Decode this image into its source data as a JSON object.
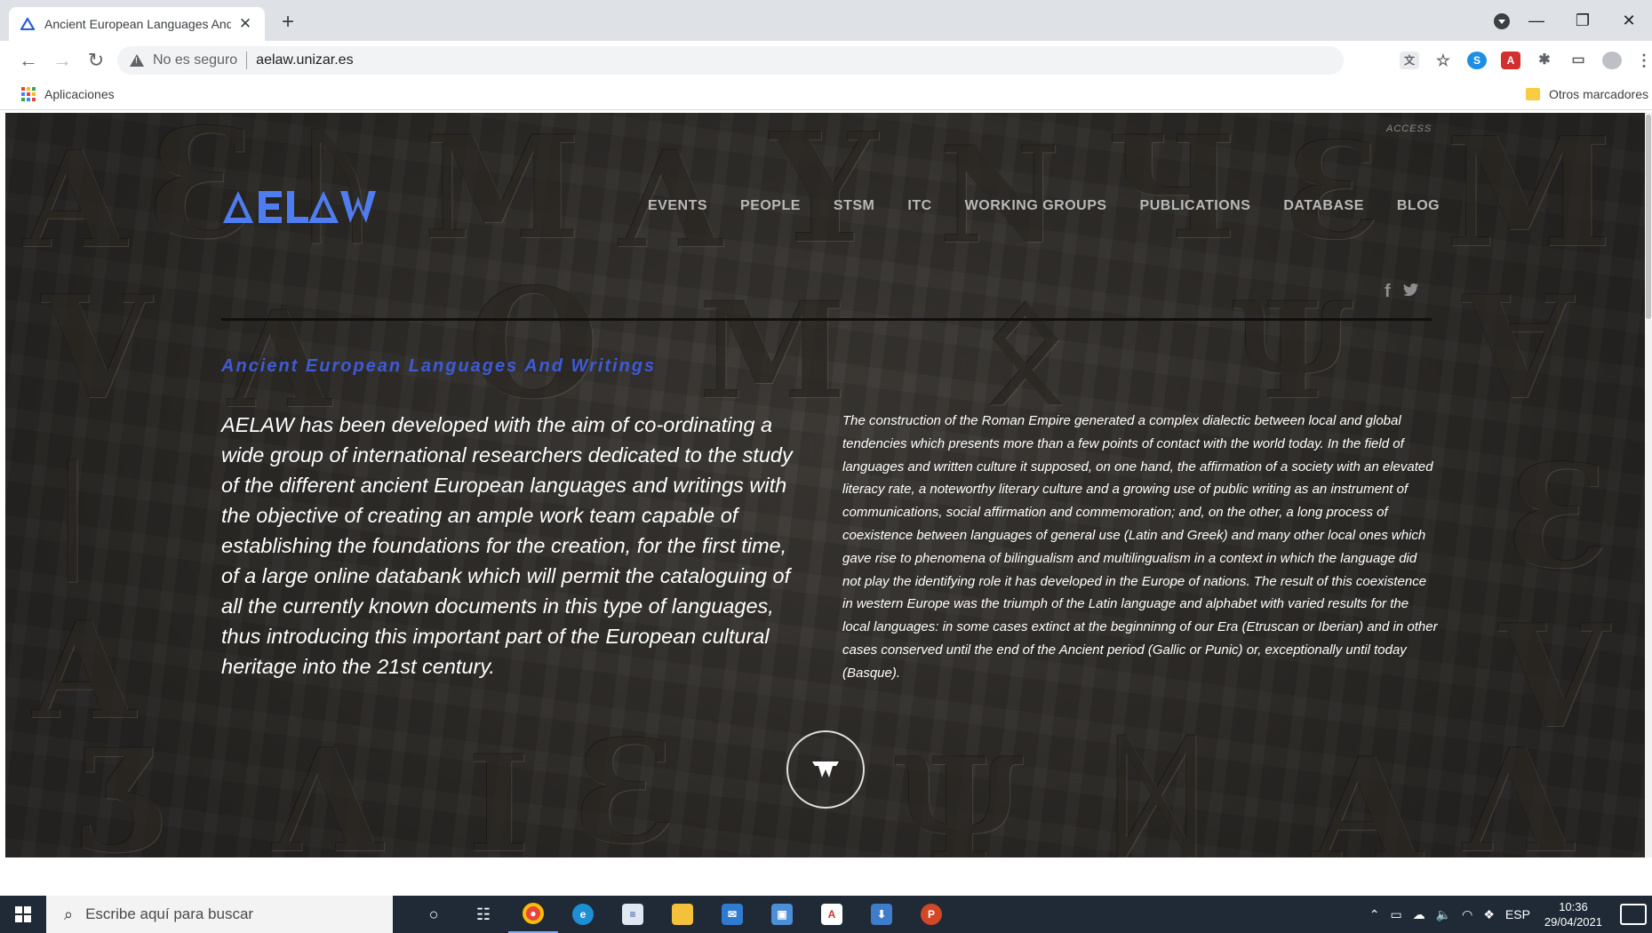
{
  "browser": {
    "tab_title": "Ancient European Languages And Writings",
    "new_tab_symbol": "+",
    "close_symbol": "✕",
    "window_controls": {
      "minimize": "—",
      "restore": "❐",
      "close": "✕"
    },
    "security_label": "No es seguro",
    "url": "aelaw.unizar.es",
    "bookmarks": {
      "apps_label": "Aplicaciones",
      "other_label": "Otros marcadores"
    }
  },
  "site": {
    "access_label": "ACCESS",
    "logo_text": "ΔELΔW",
    "nav": [
      "EVENTS",
      "PEOPLE",
      "STSM",
      "ITC",
      "WORKING GROUPS",
      "PUBLICATIONS",
      "DATABASE",
      "BLOG"
    ],
    "social": {
      "facebook": "f",
      "twitter": "🐦"
    },
    "subtitle": "Ancient European Languages And Writings",
    "lead_text": "AELAW has been developed with the aim of co-ordinating a wide group of international researchers dedicated to the study of the different ancient European languages and writings with the objective of creating an ample work team capable of establishing the foundations for the creation, for the first time, of a large online databank which will permit the cataloguing of all the currently known documents in this type of languages, thus introducing this important part of the European cultural heritage into the 21st century.",
    "body_text": "The construction of the Roman Empire generated a complex dialectic between local and global tendencies which presents more than a few points of contact with the world today. In the field of languages and written culture it supposed, on one hand, the affirmation of a society with an elevated literacy rate, a noteworthy literary culture and a growing use of public writing as an instrument of communications, social affirmation and commemoration; and, on the other, a long process of coexistence between languages of general use (Latin and Greek) and many other local ones which gave rise to phenomena of bilingualism and multilingualism in a context in which the language did not play the identifying role it has developed in the Europe of nations. The result of this coexistence in western Europe was the triumph of the Latin language and alphabet with varied results for the local languages: in some cases extinct at the beginninng of our Era (Etruscan or Iberian) and in other cases conserved until the end of the Ancient period (Gallic or Punic) or, exceptionally until today (Basque).",
    "scroll_button_icon": "w-logo-icon"
  },
  "taskbar": {
    "search_placeholder": "Escribe aquí para buscar",
    "language": "ESP",
    "time": "10:36",
    "date": "29/04/2021"
  },
  "colors": {
    "accent_blue": "#3d5bd6",
    "logo_blue": "#4f7df0",
    "nav_text": "#b9b9b9",
    "background_stone": "#3b3834"
  }
}
